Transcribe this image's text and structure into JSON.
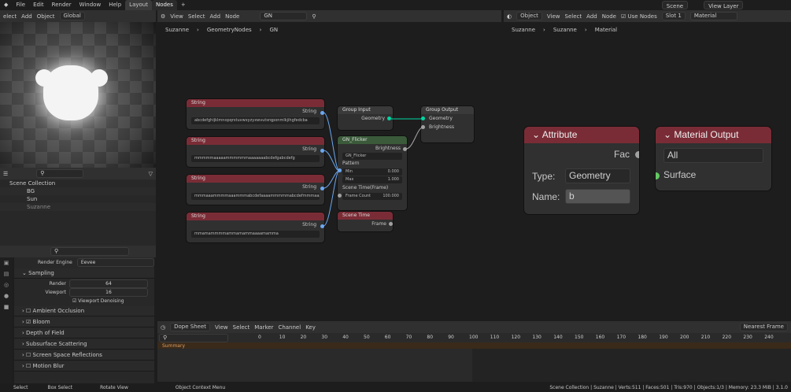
{
  "topbar": {
    "menus": [
      "elect",
      "Add",
      "Object"
    ],
    "main_menus": [
      "File",
      "Edit",
      "Render",
      "Window",
      "Help"
    ],
    "tabs": [
      "Layout",
      "Nodes"
    ],
    "orientation": "Global"
  },
  "node_header": {
    "menus": [
      "View",
      "Select",
      "Add",
      "Node"
    ],
    "tree": "GN"
  },
  "node_breadcrumb": [
    "Suzanne",
    "GeometryNodes",
    "GN"
  ],
  "shader_header": {
    "mode": "Object",
    "menus": [
      "View",
      "Select",
      "Add",
      "Node"
    ],
    "use_nodes": "Use Nodes",
    "slot": "Slot 1",
    "material": "Material"
  },
  "shader_breadcrumb": [
    "Suzanne",
    "Suzanne",
    "Material"
  ],
  "scene_fields": {
    "scene": "Scene",
    "view_layer": "View Layer"
  },
  "string_nodes": [
    {
      "title": "String",
      "out": "String",
      "value": "abcdefghijklmnopqrstuvwxyzyxwvutsrqponmlkjihgfedcba"
    },
    {
      "title": "String",
      "out": "String",
      "value": "mmmmmaaaaammmmmmaaaaaaabcdefgabcdefg"
    },
    {
      "title": "String",
      "out": "String",
      "value": "mmmaaammmmaaammmabcdefaaaammmmmabcdefmmmaaaa"
    },
    {
      "title": "String",
      "out": "String",
      "value": "mmamammmmammamammaaaamamma"
    }
  ],
  "group_input": {
    "title": "Group Input",
    "geometry": "Geometry"
  },
  "group_output": {
    "title": "Group Output",
    "geometry": "Geometry",
    "brightness": "Brightness"
  },
  "gn_flicker": {
    "title": "GN_Flicker",
    "brightness": "Brightness",
    "tree": "GN_Flicker",
    "pattern": "Pattern",
    "min_label": "Min",
    "min": "0.000",
    "max_label": "Max",
    "max": "1.000",
    "scene_time": "Scene Time(Frame)",
    "frame_count_label": "Frame Count",
    "frame_count": "100.000"
  },
  "scene_time_node": {
    "title": "Scene Time",
    "frame": "Frame"
  },
  "attribute_node": {
    "title": "Attribute",
    "fac": "Fac",
    "type_label": "Type:",
    "type_value": "Geometry",
    "name_label": "Name:",
    "name_value": "b"
  },
  "material_output": {
    "title": "Material Output",
    "target": "All",
    "surface": "Surface"
  },
  "outliner": {
    "collection": "Scene Collection",
    "items": [
      "BG",
      "Sun",
      "Suzanne"
    ]
  },
  "render": {
    "engine_label": "Render Engine",
    "engine": "Eevee",
    "sampling": "Sampling",
    "render_label": "Render",
    "render_value": "64",
    "viewport_label": "Viewport",
    "viewport_value": "16",
    "denoise": "Viewport Denoising",
    "sections": [
      "Ambient Occlusion",
      "Bloom",
      "Depth of Field",
      "Subsurface Scattering",
      "Screen Space Reflections",
      "Motion Blur"
    ]
  },
  "dopesheet": {
    "mode": "Dope Sheet",
    "menus": [
      "View",
      "Select",
      "Marker",
      "Channel",
      "Key"
    ],
    "summary": "Summary",
    "keying": "Nearest Frame",
    "ticks": [
      "0",
      "10",
      "20",
      "30",
      "40",
      "50",
      "60",
      "70",
      "80",
      "90",
      "100",
      "110",
      "120",
      "130",
      "140",
      "150",
      "160",
      "170",
      "180",
      "190",
      "200",
      "210",
      "220",
      "230",
      "240"
    ]
  },
  "statusbar": {
    "select": "Select",
    "box": "Box Select",
    "rotate": "Rotate View",
    "context": "Object Context Menu",
    "stats": "Scene Collection | Suzanne | Verts:511 | Faces:501 | Tris:970 | Objects:1/3 | Memory: 23.3 MiB | 3.1.0"
  }
}
